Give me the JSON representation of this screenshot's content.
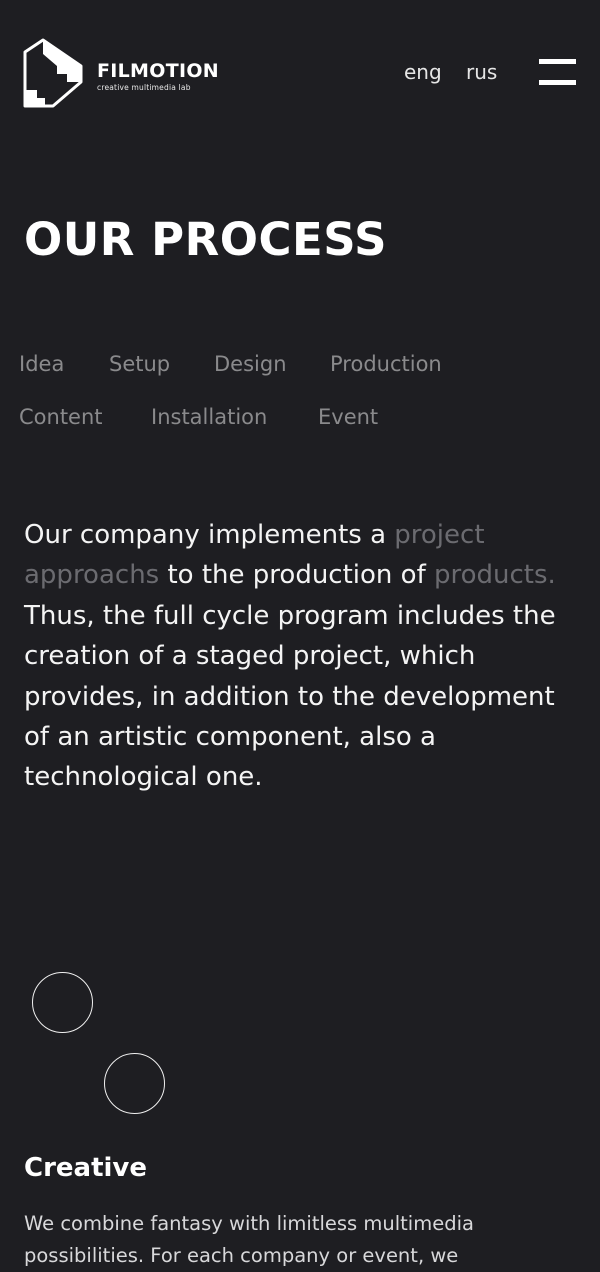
{
  "header": {
    "logo": {
      "name": "FILMOTION",
      "tagline": "creative multimedia lab"
    },
    "languages": [
      "eng",
      "rus"
    ],
    "menu_icon": "hamburger-menu-icon"
  },
  "page": {
    "title": "OUR PROCESS"
  },
  "tabs": [
    "Idea",
    "Setup",
    "Design",
    "Production",
    "Content",
    "Installation",
    "Event"
  ],
  "intro": {
    "part1": "Our company implements a ",
    "highlight1": "project approachs",
    "part2": " to the production of ",
    "highlight2": "products.",
    "part3": " Thus, the full cycle program includes the creation of a staged project, which provides, in addition to the development of an artistic component, also a technological one."
  },
  "section": {
    "title": "Creative",
    "text": "We combine fantasy with limitless multimedia possibilities. For each company or event, we"
  },
  "colors": {
    "background": "#1e1e22",
    "text": "#f4f4f4",
    "muted_tab": "#8a8a8c",
    "muted_highlight": "#6b6b70"
  }
}
